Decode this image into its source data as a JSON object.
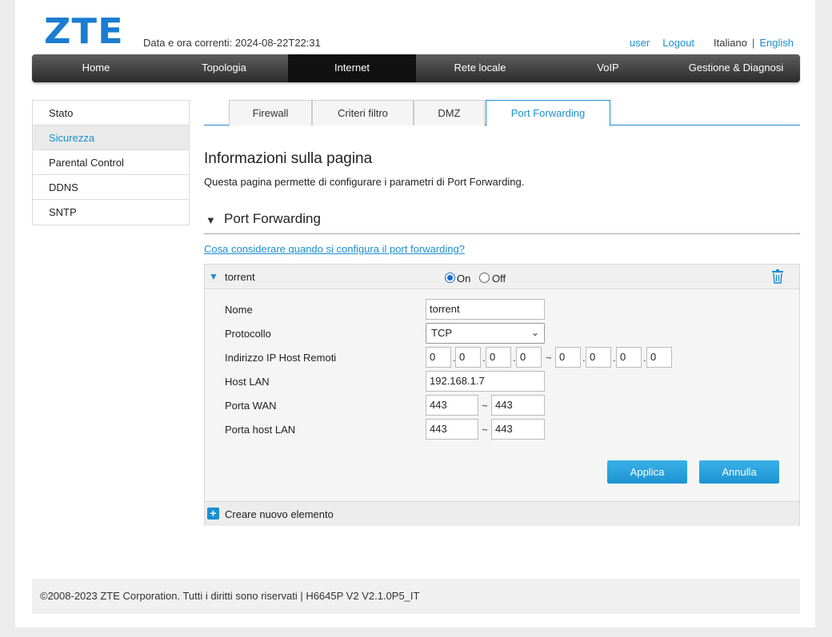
{
  "header": {
    "logo": "ZTE",
    "datetime": "Data e ora correnti: 2024-08-22T22:31",
    "links": {
      "user": "user",
      "logout": "Logout",
      "lang_current": "Italiano",
      "sep": "|",
      "lang_other": "English"
    }
  },
  "nav": [
    "Home",
    "Topologia",
    "Internet",
    "Rete locale",
    "VoIP",
    "Gestione & Diagnosi"
  ],
  "nav_active": "Internet",
  "sidebar": [
    "Stato",
    "Sicurezza",
    "Parental Control",
    "DDNS",
    "SNTP"
  ],
  "sidebar_active": "Sicurezza",
  "tabs": [
    "Firewall",
    "Criteri filtro",
    "DMZ",
    "Port Forwarding"
  ],
  "tab_active": "Port Forwarding",
  "page": {
    "title": "Informazioni sulla pagina",
    "description": "Questa pagina permette di configurare i parametri di Port Forwarding."
  },
  "section": {
    "title": "Port Forwarding",
    "help_link": "Cosa considerare quando si configura il port forwarding?"
  },
  "rule": {
    "name": "torrent",
    "on_label": "On",
    "off_label": "Off",
    "state": "On",
    "fields": {
      "nome_label": "Nome",
      "nome_value": "torrent",
      "protocollo_label": "Protocollo",
      "protocollo_value": "TCP",
      "ip_label": "Indirizzo IP Host Remoti",
      "ip_start": [
        "0",
        "0",
        "0",
        "0"
      ],
      "ip_end": [
        "0",
        "0",
        "0",
        "0"
      ],
      "range_sep": "~",
      "host_lan_label": "Host LAN",
      "host_lan_value": "192.168.1.7",
      "porta_wan_label": "Porta WAN",
      "porta_wan_start": "443",
      "porta_wan_end": "443",
      "porta_lan_label": "Porta host LAN",
      "porta_lan_start": "443",
      "porta_lan_end": "443"
    },
    "apply_label": "Applica",
    "cancel_label": "Annulla"
  },
  "new_element_label": "Creare nuovo elemento",
  "footer": "©2008-2023 ZTE Corporation. Tutti i diritti sono riservati  |   H6645P V2 V2.1.0P5_IT",
  "colors": {
    "accent": "#1a8fd1",
    "nav_bg": "#3a3a3a",
    "button": "#1c94d2"
  }
}
